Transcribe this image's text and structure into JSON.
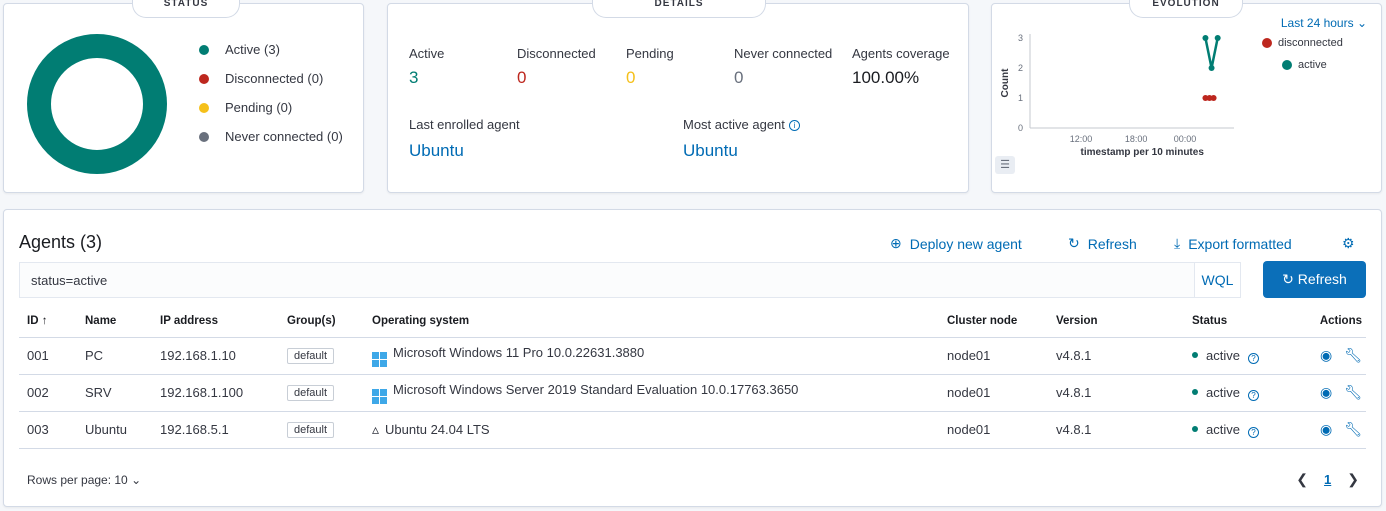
{
  "status": {
    "title": "STATUS",
    "legend": [
      {
        "label": "Active (3)",
        "color": "#017d73"
      },
      {
        "label": "Disconnected (0)",
        "color": "#bd271e"
      },
      {
        "label": "Pending (0)",
        "color": "#f5c01a"
      },
      {
        "label": "Never connected (0)",
        "color": "#69707d"
      }
    ],
    "donut_color": "#017d73"
  },
  "details": {
    "title": "DETAILS",
    "active_label": "Active",
    "active_value": "3",
    "disconnected_label": "Disconnected",
    "disconnected_value": "0",
    "pending_label": "Pending",
    "pending_value": "0",
    "never_label": "Never connected",
    "never_value": "0",
    "coverage_label": "Agents coverage",
    "coverage_value": "100.00%",
    "last_enrolled_label": "Last enrolled agent",
    "last_enrolled_value": "Ubuntu",
    "most_active_label": "Most active agent",
    "most_active_value": "Ubuntu"
  },
  "evolution": {
    "title": "EVOLUTION",
    "range": "Last 24 hours",
    "legend": [
      {
        "label": "disconnected",
        "color": "#bd271e"
      },
      {
        "label": "active",
        "color": "#017d73"
      }
    ]
  },
  "chart_data": {
    "type": "line",
    "title": "",
    "xlabel": "timestamp per 10 minutes",
    "ylabel": "Count",
    "x_ticks": [
      "12:00",
      "18:00",
      "00:00"
    ],
    "y_ticks": [
      "0",
      "1",
      "2",
      "3"
    ],
    "ylim": [
      0,
      3
    ],
    "series": [
      {
        "name": "active",
        "color": "#017d73",
        "points": [
          [
            0.86,
            3
          ],
          [
            0.89,
            2
          ],
          [
            0.92,
            3
          ]
        ]
      },
      {
        "name": "disconnected",
        "color": "#bd271e",
        "points": [
          [
            0.86,
            1
          ],
          [
            0.88,
            1
          ],
          [
            0.9,
            1
          ]
        ]
      }
    ]
  },
  "agents": {
    "title": "Agents (3)",
    "deploy_label": "Deploy new agent",
    "refresh_link_label": "Refresh",
    "export_label": "Export formatted",
    "search_query": "status=active",
    "wql_label": "WQL",
    "refresh_button_label": "Refresh",
    "columns": [
      "ID ↑",
      "Name",
      "IP address",
      "Group(s)",
      "Operating system",
      "Cluster node",
      "Version",
      "Status",
      "Actions"
    ],
    "rows": [
      {
        "id": "001",
        "name": "PC",
        "ip": "192.168.1.10",
        "group": "default",
        "os": "Microsoft Windows 11 Pro 10.0.22631.3880",
        "os_icon": "windows-icon",
        "node": "node01",
        "version": "v4.8.1",
        "status": "active"
      },
      {
        "id": "002",
        "name": "SRV",
        "ip": "192.168.1.100",
        "group": "default",
        "os": "Microsoft Windows Server 2019 Standard Evaluation 10.0.17763.3650",
        "os_icon": "windows-icon",
        "node": "node01",
        "version": "v4.8.1",
        "status": "active"
      },
      {
        "id": "003",
        "name": "Ubuntu",
        "ip": "192.168.5.1",
        "group": "default",
        "os": "Ubuntu 24.04 LTS",
        "os_icon": "linux-icon",
        "node": "node01",
        "version": "v4.8.1",
        "status": "active"
      }
    ],
    "rows_per_page": "Rows per page: 10",
    "current_page": "1"
  }
}
